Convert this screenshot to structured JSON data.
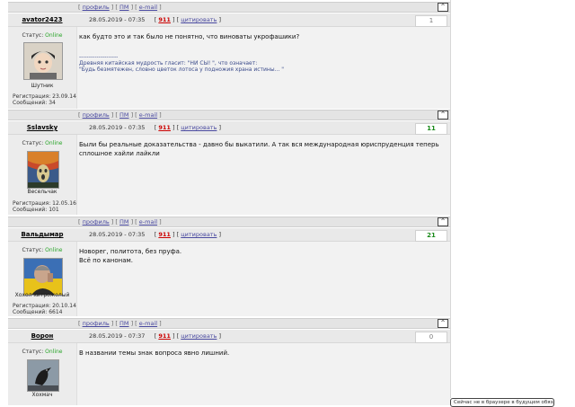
{
  "bar": {
    "profile": "профиль",
    "pm": "ПМ",
    "email": "e-mail",
    "up": "^"
  },
  "posts": [
    {
      "username": "avator2423",
      "date": "28.05.2019 - 07:35",
      "post_num": "911",
      "quote": "цитировать",
      "rating": "1",
      "status_label": "Статус:",
      "status_value": "Online",
      "user_title": "Шутник",
      "reg": "Регистрация: 23.09.14",
      "msgs": "Сообщений: 34",
      "text": "как будто это и так было не понятно, что виноваты укрофашики?",
      "sig_line": "--------------------",
      "sig_1": "Древняя китайская мудрость гласит: \"НИ СЫ! \", что означает:",
      "sig_2": "\"Будь безмятежен, словно цветок лотоса у подножия храна истины... \""
    },
    {
      "username": "Sslavsky",
      "date": "28.05.2019 - 07:35",
      "post_num": "911",
      "quote": "цитировать",
      "rating": "11",
      "status_label": "Статус:",
      "status_value": "Online",
      "user_title": "Весельчак",
      "reg": "Регистрация: 12.05.16",
      "msgs": "Сообщений: 101",
      "text_1": "Были бы реальные доказательства - давно бы выкатили. А так вся международная юриспруденция теперь",
      "text_2": "сплошное хайли лайкли"
    },
    {
      "username": "Вальдымар",
      "date": "28.05.2019 - 07:35",
      "post_num": "911",
      "quote": "цитировать",
      "rating": "21",
      "status_label": "Статус:",
      "status_value": "Online",
      "user_title": "Хохол хитрожолый",
      "reg": "Регистрация: 20.10.14",
      "msgs": "Сообщений: 6614",
      "text_1": "Новорег, политота, без пруфа.",
      "text_2": "Всё по канонам."
    },
    {
      "username": "Ворон",
      "date": "28.05.2019 - 07:37",
      "post_num": "911",
      "quote": "цитировать",
      "rating": "0",
      "status_label": "Статус:",
      "status_value": "Online",
      "user_title": "Хохмач",
      "text": "В названии темы знак вопроса явно лишний."
    }
  ],
  "popup": "Сейчас не в браузере в будущем обязать"
}
